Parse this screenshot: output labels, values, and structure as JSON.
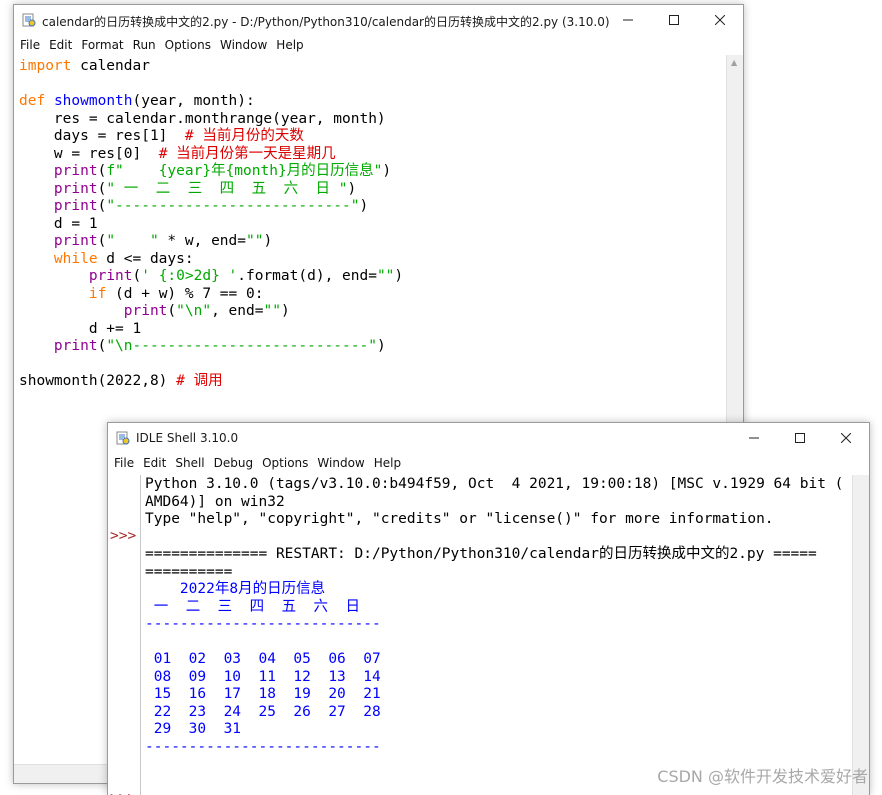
{
  "editor": {
    "title": "calendar的日历转换成中文的2.py - D:/Python/Python310/calendar的日历转换成中文的2.py (3.10.0)",
    "menu": [
      "File",
      "Edit",
      "Format",
      "Run",
      "Options",
      "Window",
      "Help"
    ]
  },
  "shell": {
    "title": "IDLE Shell 3.10.0",
    "menu": [
      "File",
      "Edit",
      "Shell",
      "Debug",
      "Options",
      "Window",
      "Help"
    ],
    "banner": [
      "Python 3.10.0 (tags/v3.10.0:b494f59, Oct  4 2021, 19:00:18) [MSC v.1929 64 bit (",
      "AMD64)] on win32",
      "Type \"help\", \"copyright\", \"credits\" or \"license()\" for more information."
    ],
    "restart_line": "============== RESTART: D:/Python/Python310/calendar的日历转换成中文的2.py =====",
    "restart_cont": "==========",
    "prompt": ">>>",
    "calendar_output": {
      "header": "    2022年8月的日历信息",
      "weekdays": " 一  二  三  四  五  六  日",
      "separator": "---------------------------",
      "rows": [
        " 01  02  03  04  05  06  07",
        " 08  09  10  11  12  13  14",
        " 15  16  17  18  19  20  21",
        " 22  23  24  25  26  27  28",
        " 29  30  31"
      ]
    }
  },
  "watermark": "CSDN @软件开发技术爱好者"
}
